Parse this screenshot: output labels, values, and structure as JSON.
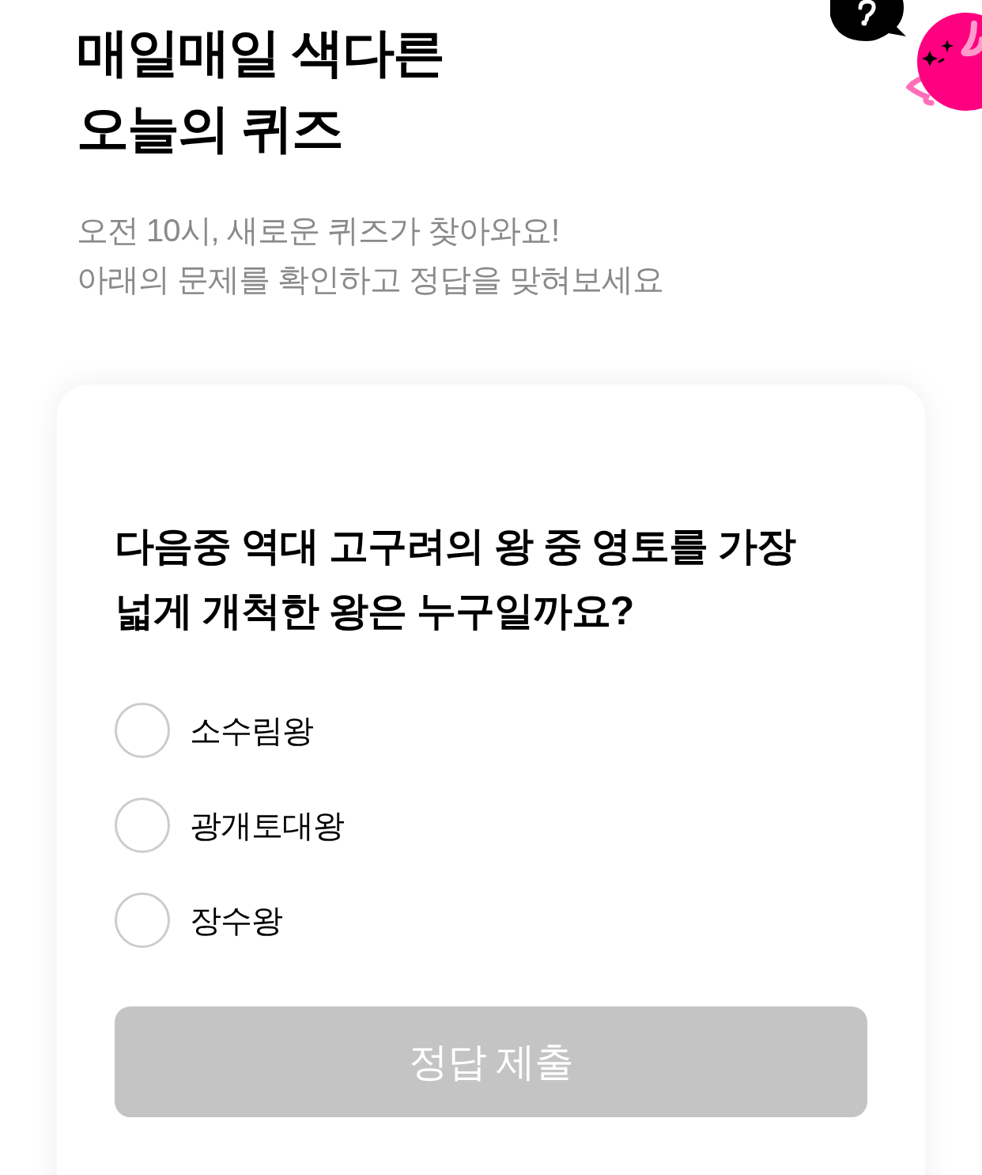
{
  "header": {
    "title_lines": [
      "매일매일 색다른",
      "오늘의 퀴즈"
    ],
    "subtitle_lines": [
      "오전 10시, 새로운 퀴즈가 찾아와요!",
      "아래의 문제를 확인하고 정답을 맞혀보세요"
    ]
  },
  "quiz": {
    "question_lines": [
      "다음중 역대 고구려의 왕 중 영토를 가장",
      "넓게 개척한 왕은 누구일까요?"
    ],
    "options": [
      {
        "label": "소수림왕",
        "selected": false
      },
      {
        "label": "광개토대왕",
        "selected": false
      },
      {
        "label": "장수왕",
        "selected": false
      }
    ],
    "submit_button": {
      "label": "정답 제출",
      "disabled": true
    }
  }
}
